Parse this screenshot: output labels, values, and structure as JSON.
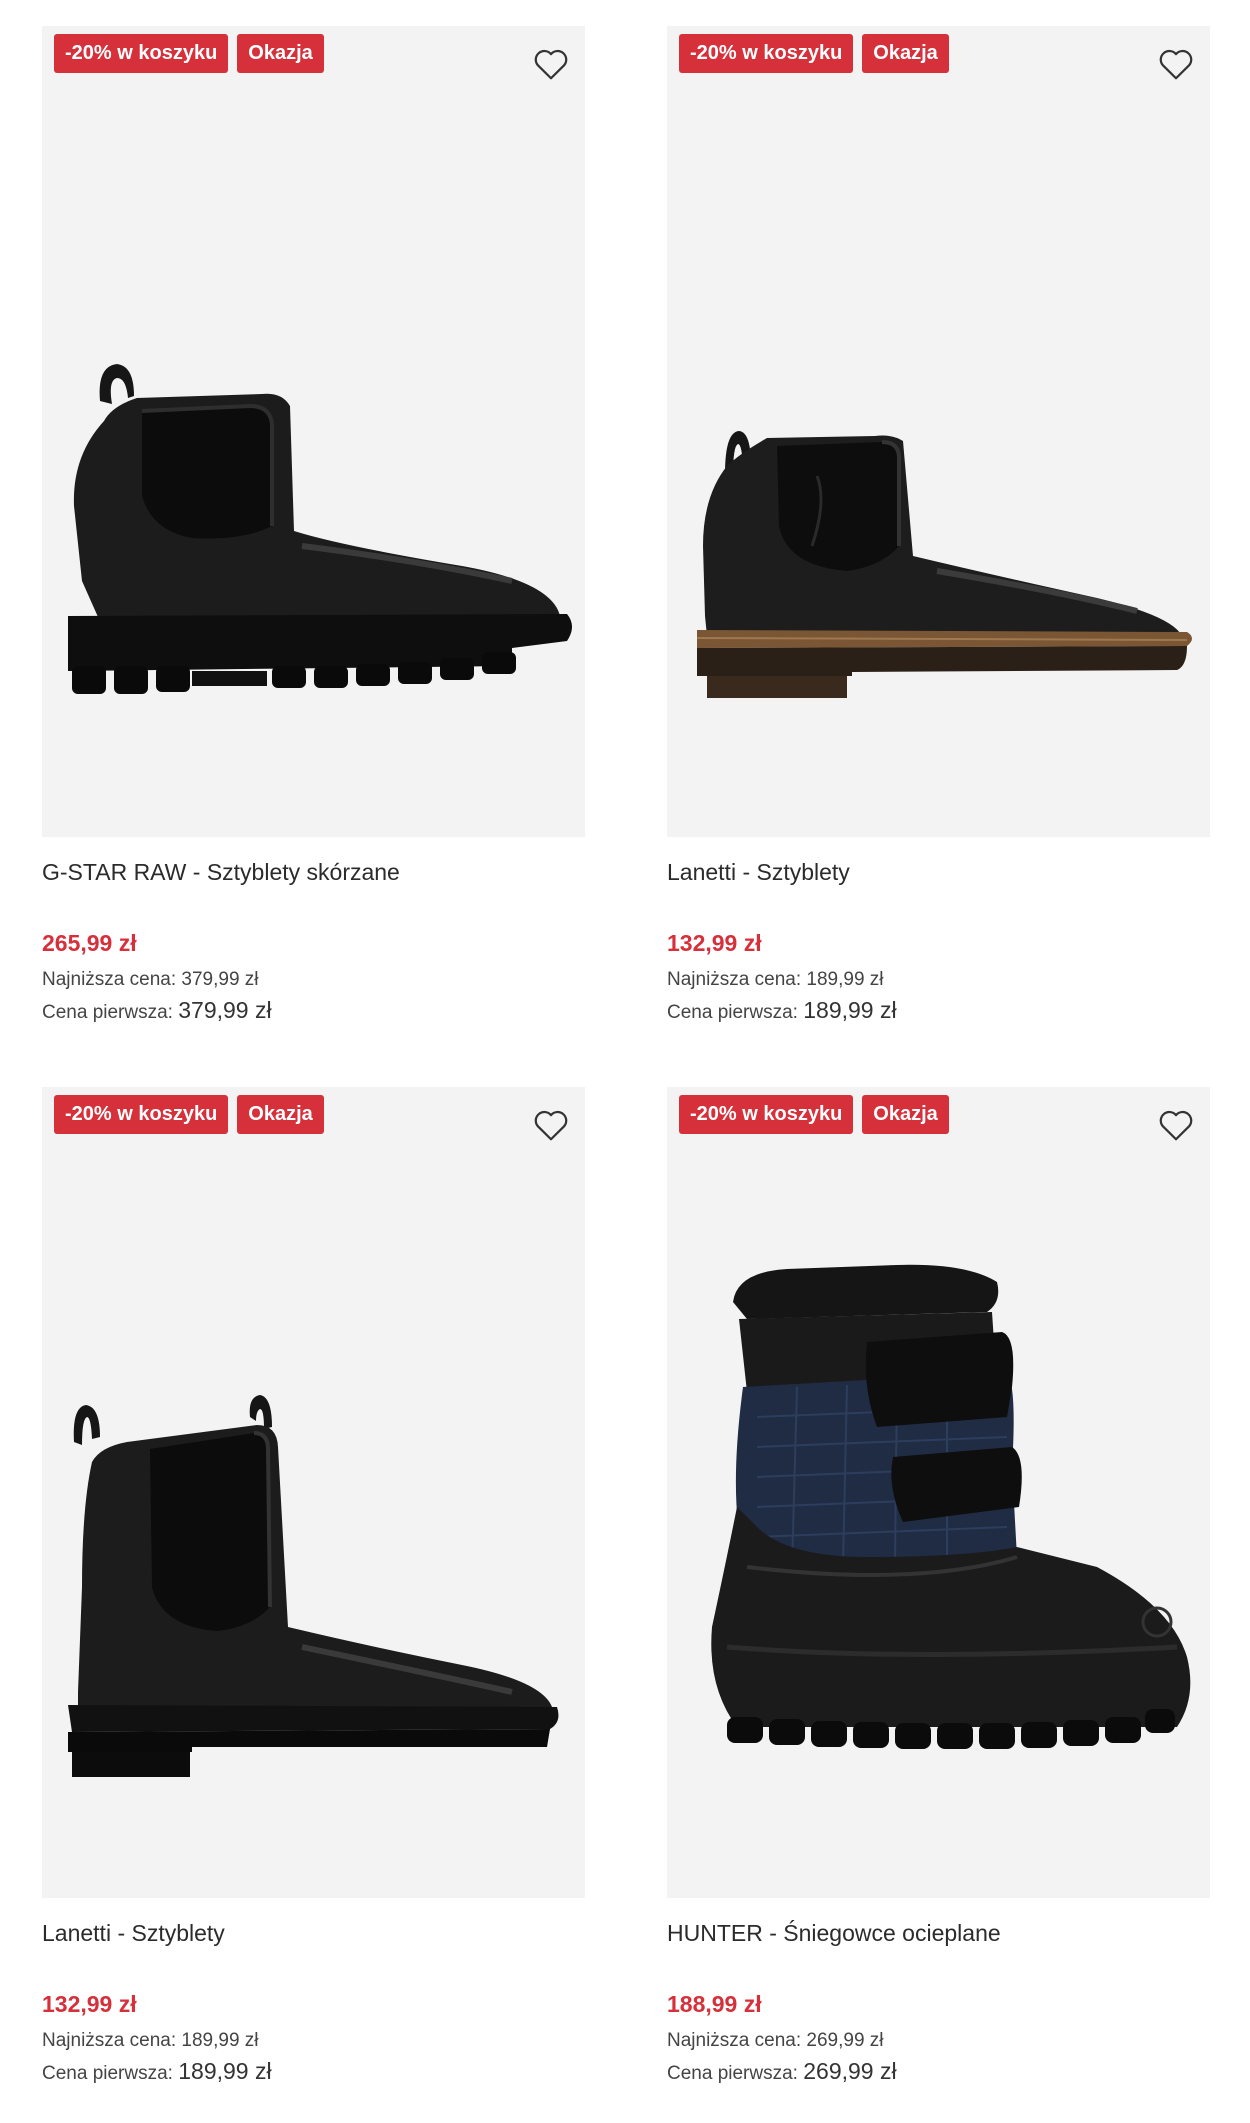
{
  "products": [
    {
      "badges": [
        "-20% w koszyku",
        "Okazja"
      ],
      "name": "G-STAR RAW - Sztyblety skórzane",
      "price": "265,99 zł",
      "lowest_label": "Najniższa cena:",
      "lowest_value": "379,99 zł",
      "original_label": "Cena pierwsza:",
      "original_value": "379,99 zł",
      "image": "black-chelsea-boot-lug-sole"
    },
    {
      "badges": [
        "-20% w koszyku",
        "Okazja"
      ],
      "name": "Lanetti - Sztyblety",
      "price": "132,99 zł",
      "lowest_label": "Najniższa cena:",
      "lowest_value": "189,99 zł",
      "original_label": "Cena pierwsza:",
      "original_value": "189,99 zł",
      "image": "black-chelsea-boot-brown-sole"
    },
    {
      "badges": [
        "-20% w koszyku",
        "Okazja"
      ],
      "name": "Lanetti - Sztyblety",
      "price": "132,99 zł",
      "lowest_label": "Najniższa cena:",
      "lowest_value": "189,99 zł",
      "original_label": "Cena pierwsza:",
      "original_value": "189,99 zł",
      "image": "black-chelsea-boot-tall"
    },
    {
      "badges": [
        "-20% w koszyku",
        "Okazja"
      ],
      "name": "HUNTER - Śniegowce ocieplane",
      "price": "188,99 zł",
      "lowest_label": "Najniższa cena:",
      "lowest_value": "269,99 zł",
      "original_label": "Cena pierwsza:",
      "original_value": "269,99 zł",
      "image": "navy-black-snow-boot"
    }
  ],
  "colors": {
    "badge": "#d6303b",
    "price": "#d6303b",
    "photo_bg": "#f3f3f3"
  },
  "icons": {
    "favorite": "heart-outline-icon"
  }
}
